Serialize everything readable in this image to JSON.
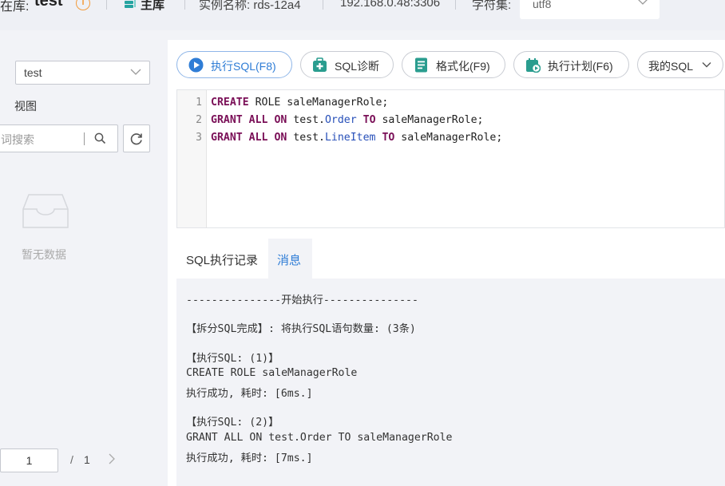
{
  "header": {
    "db_label": "在库:",
    "db_name": "test",
    "info_glyph": "i",
    "role_label": "主库",
    "instance_label": "实例名称: rds-12a4",
    "host": "192.168.0.48:3306",
    "charset_label": "字符集:",
    "charset_value": "utf8",
    "info_icon_color": "#f39c3d"
  },
  "sidebar": {
    "db_select_value": "test",
    "view_label": "视图",
    "search_placeholder": "词搜索",
    "empty_text": "暂无数据",
    "page_current": "1",
    "page_separator": "/",
    "page_total": "1"
  },
  "toolbar": {
    "execute_label": "执行SQL(F8)",
    "diagnose_label": "SQL诊断",
    "format_label": "格式化(F9)",
    "plan_label": "执行计划(F6)",
    "my_sql_label": "我的SQL",
    "accent_color": "#2f7dd6"
  },
  "editor": {
    "line_numbers": [
      "1",
      "2",
      "3"
    ],
    "lines": [
      [
        {
          "t": "CREATE",
          "c": "kw"
        },
        {
          "t": " ",
          "c": ""
        },
        {
          "t": "ROLE saleManagerRole;",
          "c": ""
        }
      ],
      [
        {
          "t": "GRANT",
          "c": "kw"
        },
        {
          "t": " ",
          "c": ""
        },
        {
          "t": "ALL",
          "c": "kw"
        },
        {
          "t": " ",
          "c": ""
        },
        {
          "t": "ON",
          "c": "kw"
        },
        {
          "t": " test.",
          "c": ""
        },
        {
          "t": "Order",
          "c": "id"
        },
        {
          "t": " ",
          "c": ""
        },
        {
          "t": "TO",
          "c": "kw"
        },
        {
          "t": " saleManagerRole;",
          "c": ""
        }
      ],
      [
        {
          "t": "GRANT",
          "c": "kw"
        },
        {
          "t": " ",
          "c": ""
        },
        {
          "t": "ALL",
          "c": "kw"
        },
        {
          "t": " ",
          "c": ""
        },
        {
          "t": "ON",
          "c": "kw"
        },
        {
          "t": " test.",
          "c": ""
        },
        {
          "t": "LineItem",
          "c": "id"
        },
        {
          "t": " ",
          "c": ""
        },
        {
          "t": "TO",
          "c": "kw"
        },
        {
          "t": " saleManagerRole;",
          "c": ""
        }
      ]
    ]
  },
  "tabs": {
    "history_label": "SQL执行记录",
    "message_label": "消息"
  },
  "output": {
    "lines": [
      "---------------开始执行---------------",
      "【拆分SQL完成】: 将执行SQL语句数量: (3条)",
      "【执行SQL: (1)】",
      "CREATE ROLE saleManagerRole",
      "执行成功, 耗时: [6ms.]",
      "【执行SQL: (2)】",
      "GRANT ALL ON test.Order TO saleManagerRole",
      "执行成功, 耗时: [7ms.]"
    ]
  }
}
